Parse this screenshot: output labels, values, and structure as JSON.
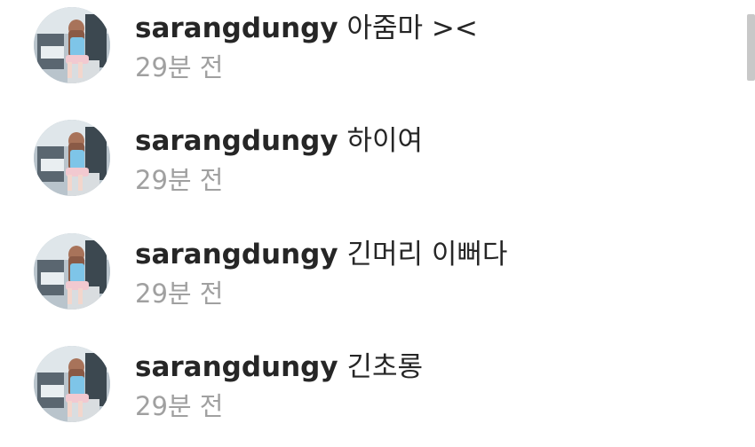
{
  "comments": [
    {
      "username": "sarangdungy",
      "text": "아줌마 ><",
      "time": "29분 전",
      "avatar_icon": "profile-photo"
    },
    {
      "username": "sarangdungy",
      "text": "하이여",
      "time": "29분 전",
      "avatar_icon": "profile-photo"
    },
    {
      "username": "sarangdungy",
      "text": "긴머리 이뻐다",
      "time": "29분 전",
      "avatar_icon": "profile-photo"
    },
    {
      "username": "sarangdungy",
      "text": "긴초롱",
      "time": "29분 전",
      "avatar_icon": "profile-photo"
    }
  ],
  "colors": {
    "username": "#262626",
    "comment_text": "#262626",
    "timestamp": "#a0a0a0",
    "background": "#ffffff",
    "scrollbar": "#c8c8c8"
  }
}
